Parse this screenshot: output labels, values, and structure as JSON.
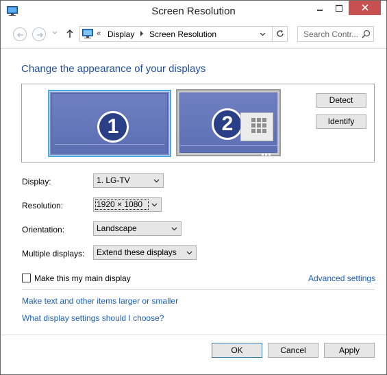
{
  "window": {
    "title": "Screen Resolution",
    "close_color": "#c75050"
  },
  "address_bar": {
    "overflow_chevron": "«",
    "breadcrumbs": [
      "Display",
      "Screen Resolution"
    ],
    "search_placeholder": "Search Contr..."
  },
  "main": {
    "heading": "Change the appearance of your displays",
    "heading_color": "#1e4e9c",
    "monitors": [
      {
        "number": "1",
        "selected": true
      },
      {
        "number": "2",
        "selected": false
      }
    ],
    "detect_label": "Detect",
    "identify_label": "Identify",
    "fields": {
      "display": {
        "label": "Display:",
        "value": "1. LG-TV"
      },
      "resolution": {
        "label": "Resolution:",
        "value": "1920 × 1080"
      },
      "orientation": {
        "label": "Orientation:",
        "value": "Landscape"
      },
      "multiple": {
        "label": "Multiple displays:",
        "value": "Extend these displays"
      }
    },
    "main_display_checkbox": {
      "label": "Make this my main display",
      "checked": false
    },
    "advanced_link": "Advanced settings",
    "links": {
      "text_size": "Make text and other items larger or smaller",
      "which_settings": "What display settings should I choose?"
    },
    "link_color": "#1b5fb5"
  },
  "footer": {
    "ok_label": "OK",
    "cancel_label": "Cancel",
    "apply_label": "Apply"
  },
  "icons": {
    "app": "display-settings-icon",
    "back": "back-arrow-icon",
    "forward": "forward-arrow-icon",
    "up": "up-arrow-icon",
    "refresh": "refresh-icon",
    "search": "search-icon"
  }
}
